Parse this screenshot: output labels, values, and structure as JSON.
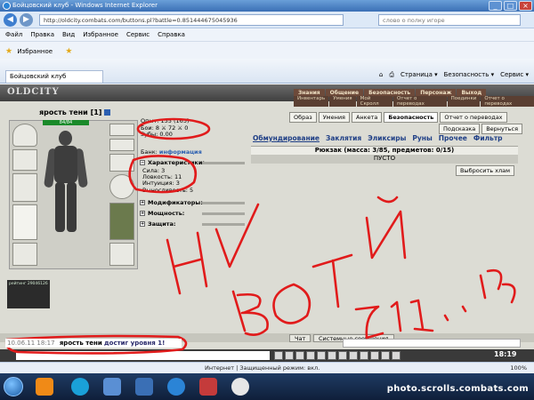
{
  "window": {
    "title": "Бойцовский клуб - Windows Internet Explorer",
    "address": "http://oldcity.combats.com/buttons.pl?battle=0.851444675045936",
    "search_placeholder": "слово о полку игоре"
  },
  "menu": [
    "Файл",
    "Правка",
    "Вид",
    "Избранное",
    "Сервис",
    "Справка"
  ],
  "favorites_label": "Избранное",
  "tab_title": "Бойцовский клуб",
  "ie_commands": [
    "Страница ▾",
    "Безопасность ▾",
    "Сервис ▾"
  ],
  "game": {
    "logo": "OLDCITY",
    "top_nav": [
      "Знания",
      "Общение",
      "Безопасность",
      "Персонаж",
      "Выход"
    ],
    "top_nav2": [
      "Инвентарь",
      "Умения",
      "Мой Скролл",
      "Отчет о переводах",
      "Поединки",
      "Отчет о переводах"
    ],
    "char_name": "ярость тени [1]",
    "hp": "84/84",
    "stats": {
      "opyt": "Опыт: 155 (165)",
      "boi": "Бои: 8 ⚔ 72 ⚔ 0",
      "zuby": "Зубы: 0.00"
    },
    "bank_label": "Банк:",
    "bank_link": "информация",
    "sections": {
      "characteristics": "Характеристики:",
      "modifiers": "Модификаторы:",
      "power": "Мощность:",
      "defense": "Защита:"
    },
    "attributes": [
      "Сила: 3",
      "Ловкость: 11",
      "Интуиция: 3",
      "Выносливость: 5"
    ],
    "rating": "рейтинг 29046126",
    "right_buttons": [
      "Образ",
      "Умения",
      "Анкета",
      "Безопасность",
      "Отчет о переводах"
    ],
    "right_buttons2": [
      "Подсказка",
      "Вернуться"
    ],
    "inv_tabs": [
      "Обмундирование",
      "Заклятия",
      "Эликсиры",
      "Руны",
      "Прочее",
      "Фильтр"
    ],
    "backpack": "Рюкзак (масса: 3/85, предметов: 0/15)",
    "empty": "ПУСТО",
    "throw_button": "Выбросить хлам"
  },
  "chat": {
    "tabs": [
      "Чат",
      "Системные сообщения"
    ],
    "log_time": "10.06.11 18:17",
    "log_name": "ярость тени",
    "log_text": "достиг уровня 1!",
    "clock": "18:19"
  },
  "statusbar": {
    "zone": "Интернет | Защищенный режим: вкл.",
    "zoom": "100%"
  },
  "scribble_text": "НУ ВОТ И [1]...!!",
  "watermark": "photo.scrolls.combats.com",
  "colors": {
    "scribble": "#e11b1b",
    "title": "#3a6fb5"
  }
}
